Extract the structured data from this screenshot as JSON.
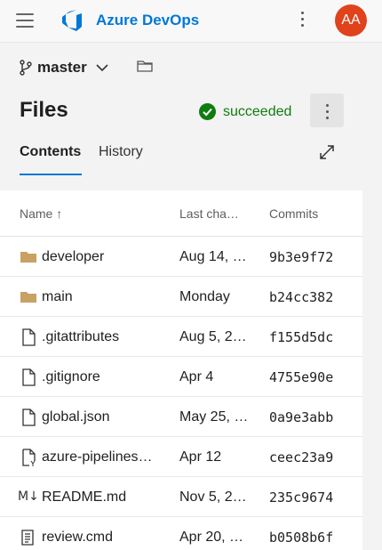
{
  "header": {
    "brand": "Azure DevOps",
    "avatar_initials": "AA",
    "avatar_color": "#e0421b",
    "accent": "#0078d4"
  },
  "branch": {
    "name": "master"
  },
  "page": {
    "title": "Files",
    "status": "succeeded",
    "status_color": "#107c10"
  },
  "tabs": [
    {
      "label": "Contents",
      "active": true
    },
    {
      "label": "History",
      "active": false
    }
  ],
  "table": {
    "columns": [
      "Name ↑",
      "Last cha…",
      "Commits"
    ],
    "rows": [
      {
        "icon": "folder-icon",
        "name": "developer",
        "last_change": "Aug 14, …",
        "commit": "9b3e9f72"
      },
      {
        "icon": "folder-icon",
        "name": "main",
        "last_change": "Monday",
        "commit": "b24cc382"
      },
      {
        "icon": "file-icon",
        "name": ".gitattributes",
        "last_change": "Aug 5, 2…",
        "commit": "f155d5dc"
      },
      {
        "icon": "file-icon",
        "name": ".gitignore",
        "last_change": "Apr 4",
        "commit": "4755e90e"
      },
      {
        "icon": "file-icon",
        "name": "global.json",
        "last_change": "May 25, …",
        "commit": "0a9e3abb"
      },
      {
        "icon": "yaml-file-icon",
        "name": "azure-pipelines…",
        "last_change": "Apr 12",
        "commit": "ceec23a9"
      },
      {
        "icon": "markdown-icon",
        "icon_text": "M↓",
        "name": "README.md",
        "last_change": "Nov 5, 2…",
        "commit": "235c9674"
      },
      {
        "icon": "script-file-icon",
        "name": "review.cmd",
        "last_change": "Apr 20, …",
        "commit": "b0508b6f"
      }
    ]
  }
}
